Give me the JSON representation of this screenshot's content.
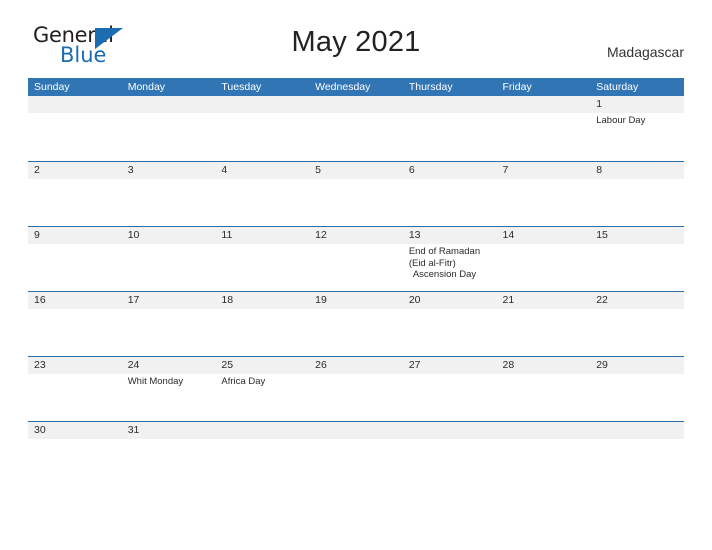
{
  "brand": {
    "name_part1": "General",
    "name_part2": "Blue",
    "triangle_color": "#1b6cb0"
  },
  "header": {
    "title": "May 2021",
    "country": "Madagascar"
  },
  "theme": {
    "header_blue": "#3275b5",
    "rule_blue": "#2c6ca8",
    "number_band_gray": "#f1f1f1",
    "text_dark": "#2b2b2b"
  },
  "calendar": {
    "weekdays": [
      "Sunday",
      "Monday",
      "Tuesday",
      "Wednesday",
      "Thursday",
      "Friday",
      "Saturday"
    ],
    "weeks": [
      {
        "days": [
          {
            "num": "",
            "events": []
          },
          {
            "num": "",
            "events": []
          },
          {
            "num": "",
            "events": []
          },
          {
            "num": "",
            "events": []
          },
          {
            "num": "",
            "events": []
          },
          {
            "num": "",
            "events": []
          },
          {
            "num": "1",
            "events": [
              {
                "text": "Labour Day",
                "indent": false
              }
            ]
          }
        ]
      },
      {
        "days": [
          {
            "num": "2",
            "events": []
          },
          {
            "num": "3",
            "events": []
          },
          {
            "num": "4",
            "events": []
          },
          {
            "num": "5",
            "events": []
          },
          {
            "num": "6",
            "events": []
          },
          {
            "num": "7",
            "events": []
          },
          {
            "num": "8",
            "events": []
          }
        ]
      },
      {
        "days": [
          {
            "num": "9",
            "events": []
          },
          {
            "num": "10",
            "events": []
          },
          {
            "num": "11",
            "events": []
          },
          {
            "num": "12",
            "events": []
          },
          {
            "num": "13",
            "events": [
              {
                "text": "End of Ramadan",
                "indent": false
              },
              {
                "text": "(Eid al-Fitr)",
                "indent": false
              },
              {
                "text": "Ascension Day",
                "indent": true
              }
            ]
          },
          {
            "num": "14",
            "events": []
          },
          {
            "num": "15",
            "events": []
          }
        ]
      },
      {
        "days": [
          {
            "num": "16",
            "events": []
          },
          {
            "num": "17",
            "events": []
          },
          {
            "num": "18",
            "events": []
          },
          {
            "num": "19",
            "events": []
          },
          {
            "num": "20",
            "events": []
          },
          {
            "num": "21",
            "events": []
          },
          {
            "num": "22",
            "events": []
          }
        ]
      },
      {
        "days": [
          {
            "num": "23",
            "events": []
          },
          {
            "num": "24",
            "events": [
              {
                "text": "Whit Monday",
                "indent": false
              }
            ]
          },
          {
            "num": "25",
            "events": [
              {
                "text": "Africa Day",
                "indent": false
              }
            ]
          },
          {
            "num": "26",
            "events": []
          },
          {
            "num": "27",
            "events": []
          },
          {
            "num": "28",
            "events": []
          },
          {
            "num": "29",
            "events": []
          }
        ]
      },
      {
        "days": [
          {
            "num": "30",
            "events": []
          },
          {
            "num": "31",
            "events": []
          },
          {
            "num": "",
            "events": []
          },
          {
            "num": "",
            "events": []
          },
          {
            "num": "",
            "events": []
          },
          {
            "num": "",
            "events": []
          },
          {
            "num": "",
            "events": []
          }
        ]
      }
    ]
  }
}
